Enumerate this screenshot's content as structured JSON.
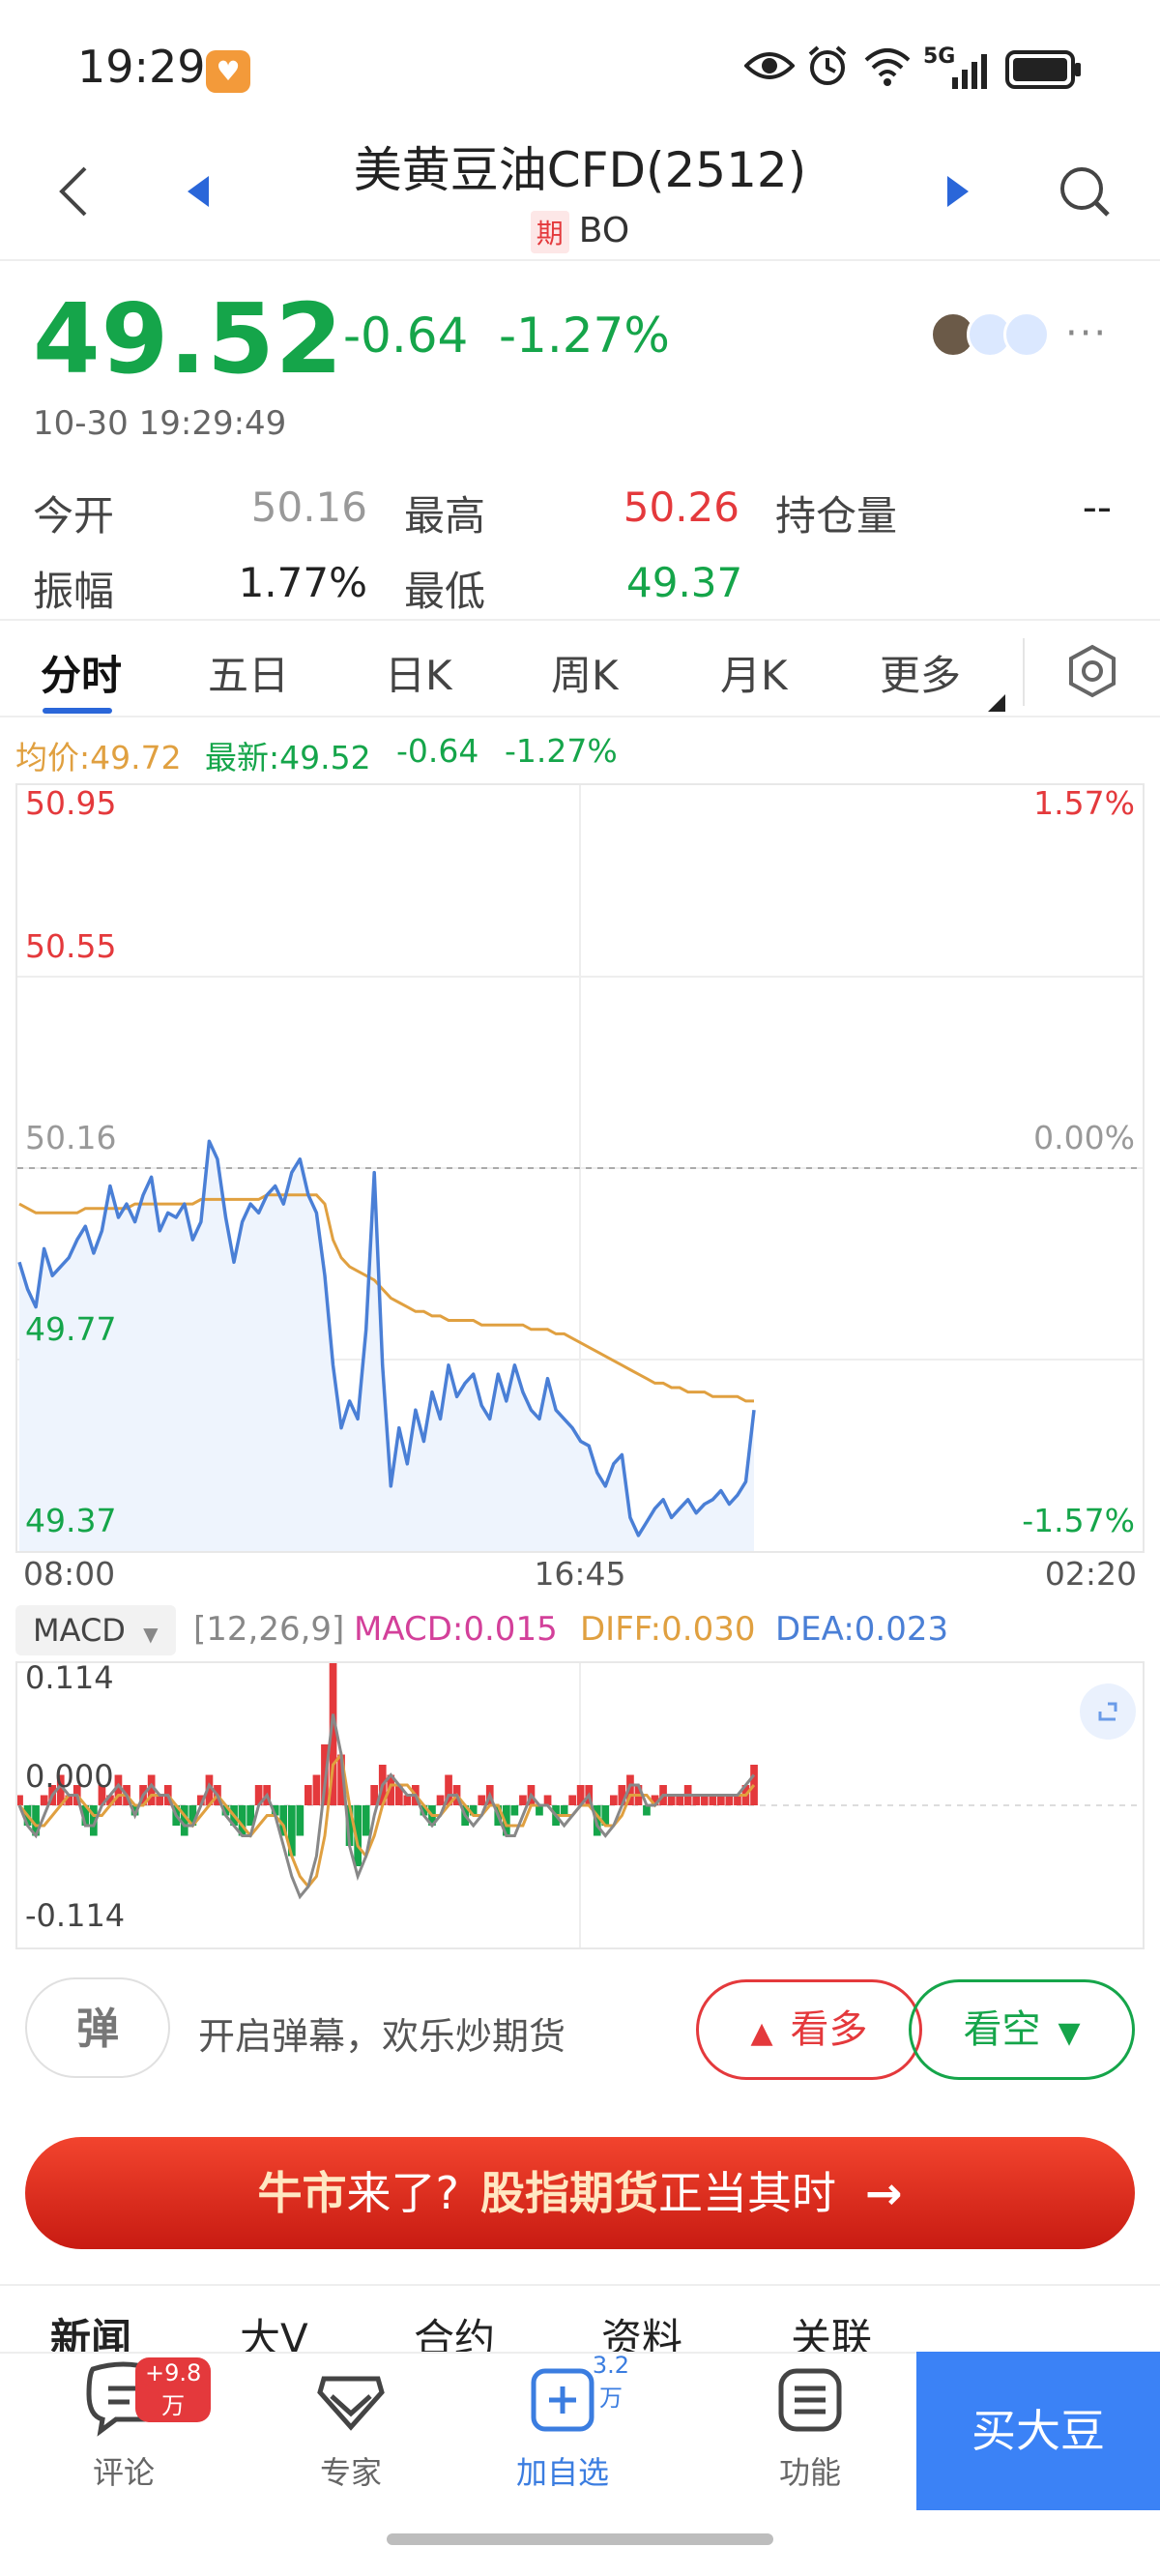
{
  "status_bar": {
    "time": "19:29",
    "network": "5G"
  },
  "header": {
    "title": "美黄豆油CFD(2512)",
    "tag": "期",
    "code": "BO"
  },
  "quote": {
    "price": "49.52",
    "change": "-0.64",
    "change_pct": "-1.27%",
    "time": "10-30 19:29:49",
    "more": "···"
  },
  "stats": [
    {
      "label": "今开",
      "value": "50.16",
      "color": "#999999"
    },
    {
      "label": "最高",
      "value": "50.26",
      "color": "#e4393c"
    },
    {
      "label": "持仓量",
      "value": "--",
      "color": "#222222"
    },
    {
      "label": "振幅",
      "value": "1.77%",
      "color": "#222222"
    },
    {
      "label": "最低",
      "value": "49.37",
      "color": "#15a54a"
    }
  ],
  "chart_tabs": [
    "分时",
    "五日",
    "日K",
    "周K",
    "月K",
    "更多"
  ],
  "legend": {
    "avg": "均价:49.72",
    "latest": "最新:49.52",
    "change": "-0.64",
    "change_pct": "-1.27%"
  },
  "macd_header": {
    "selector": "MACD",
    "params": "[12,26,9]",
    "macd": "MACD:0.015",
    "diff": "DIFF:0.030",
    "dea": "DEA:0.023"
  },
  "controls": {
    "danmu_icon": "弹",
    "danmu_text": "开启弹幕，欢乐炒期货",
    "long_label": "看多",
    "short_label": "看空"
  },
  "banner": {
    "part1": "牛市",
    "part2": "来了?",
    "part3": "股指期货",
    "part4": "正当其时",
    "arrow": "→"
  },
  "news_tabs": [
    "新闻",
    "大V",
    "合约",
    "资料",
    "关联"
  ],
  "bottom_nav": [
    {
      "label": "评论",
      "badge": "+9.8万",
      "icon": "comment-icon"
    },
    {
      "label": "专家",
      "badge": "",
      "icon": "diamond-icon"
    },
    {
      "label": "加自选",
      "badge": "3.2万",
      "icon": "add-watchlist-icon"
    },
    {
      "label": "功能",
      "badge": "",
      "icon": "menu-icon"
    }
  ],
  "buy_button": "买大豆",
  "chart_data": [
    {
      "type": "line",
      "x_ticks": [
        "08:00",
        "16:45",
        "02:20"
      ],
      "y_ticks_left": [
        "50.95",
        "50.55",
        "50.16",
        "49.77",
        "49.37"
      ],
      "y_ticks_right": [
        "1.57%",
        "0.00%",
        "-1.57%"
      ],
      "ylim": [
        49.37,
        50.95
      ],
      "reference": 50.16,
      "colors": {
        "price": "#4a7fd6",
        "avg": "#e0a040"
      },
      "series": [
        {
          "values": [
            49.95,
            49.89,
            49.85,
            49.98,
            49.92,
            49.94,
            49.96,
            50.0,
            50.03,
            49.97,
            50.02,
            50.12,
            50.05,
            50.08,
            50.04,
            50.1,
            50.14,
            50.02,
            50.06,
            50.05,
            50.08,
            50.0,
            50.04,
            50.22,
            50.18,
            50.05,
            49.95,
            50.04,
            50.08,
            50.06,
            50.1,
            50.12,
            50.08,
            50.15,
            50.18,
            50.1,
            50.06,
            49.92,
            49.72,
            49.58,
            49.64,
            49.6,
            49.8,
            50.15,
            49.72,
            49.45,
            49.58,
            49.5,
            49.62,
            49.55,
            49.66,
            49.6,
            49.72,
            49.65,
            49.68,
            49.7,
            49.63,
            49.6,
            49.7,
            49.64,
            49.72,
            49.66,
            49.62,
            49.6,
            49.69,
            49.62,
            49.6,
            49.58,
            49.55,
            49.54,
            49.48,
            49.45,
            49.5,
            49.52,
            49.38,
            49.34,
            49.37,
            49.4,
            49.42,
            49.38,
            49.4,
            49.42,
            49.39,
            49.41,
            49.42,
            49.44,
            49.41,
            49.43,
            49.46,
            49.62
          ]
        },
        {
          "values": [
            50.08,
            50.07,
            50.06,
            50.06,
            50.06,
            50.06,
            50.06,
            50.06,
            50.07,
            50.07,
            50.07,
            50.07,
            50.07,
            50.07,
            50.08,
            50.08,
            50.08,
            50.08,
            50.08,
            50.08,
            50.08,
            50.08,
            50.09,
            50.09,
            50.09,
            50.09,
            50.09,
            50.09,
            50.09,
            50.09,
            50.1,
            50.1,
            50.1,
            50.1,
            50.1,
            50.1,
            50.1,
            50.08,
            50.0,
            49.96,
            49.94,
            49.93,
            49.92,
            49.91,
            49.89,
            49.87,
            49.86,
            49.85,
            49.84,
            49.84,
            49.83,
            49.83,
            49.82,
            49.82,
            49.82,
            49.82,
            49.81,
            49.81,
            49.81,
            49.81,
            49.81,
            49.81,
            49.8,
            49.8,
            49.8,
            49.79,
            49.79,
            49.78,
            49.77,
            49.76,
            49.75,
            49.74,
            49.73,
            49.72,
            49.71,
            49.7,
            49.69,
            49.68,
            49.68,
            49.67,
            49.67,
            49.66,
            49.66,
            49.66,
            49.65,
            49.65,
            49.65,
            49.65,
            49.64,
            49.64
          ]
        }
      ]
    },
    {
      "type": "bar",
      "y_ticks": [
        "0.114",
        "0.000",
        "-0.114"
      ],
      "ylim": [
        -0.14,
        0.14
      ],
      "colors": {
        "up": "#e4393c",
        "down": "#15a54a",
        "diff": "#888888",
        "dea": "#e0a040"
      },
      "series": [
        {
          "values": [
            0.01,
            -0.02,
            -0.03,
            0.01,
            0.02,
            0.03,
            0.01,
            0.02,
            -0.02,
            -0.03,
            0.02,
            0.01,
            0.03,
            0.02,
            -0.01,
            0.02,
            0.03,
            0.01,
            0.02,
            -0.02,
            -0.03,
            -0.02,
            0.01,
            0.03,
            0.02,
            -0.01,
            -0.02,
            -0.03,
            -0.02,
            0.02,
            0.02,
            -0.01,
            -0.03,
            -0.05,
            -0.03,
            0.02,
            0.03,
            0.06,
            0.14,
            0.05,
            -0.04,
            -0.06,
            -0.03,
            0.02,
            0.04,
            0.03,
            0.02,
            0.01,
            0.02,
            -0.01,
            -0.02,
            0.01,
            0.03,
            0.02,
            -0.02,
            -0.01,
            0.01,
            0.02,
            -0.02,
            -0.03,
            -0.01,
            0.01,
            0.02,
            -0.01,
            0.01,
            -0.02,
            -0.01,
            0.01,
            0.02,
            0.02,
            -0.03,
            -0.02,
            0.01,
            0.02,
            0.03,
            0.02,
            -0.01,
            0.01,
            0.02,
            0.01,
            0.01,
            0.02,
            0.01,
            0.01,
            0.01,
            0.01,
            0.01,
            0.01,
            0.02,
            0.04
          ]
        },
        {
          "values": [
            0.0,
            -0.02,
            -0.03,
            -0.01,
            0.01,
            0.02,
            0.01,
            0.01,
            -0.02,
            -0.02,
            0.0,
            0.01,
            0.02,
            0.01,
            -0.01,
            0.01,
            0.02,
            0.01,
            0.01,
            -0.01,
            -0.02,
            -0.02,
            0.0,
            0.02,
            0.01,
            -0.01,
            -0.02,
            -0.03,
            -0.03,
            0.0,
            0.01,
            -0.01,
            -0.04,
            -0.07,
            -0.09,
            -0.08,
            -0.05,
            0.02,
            0.09,
            0.05,
            -0.04,
            -0.07,
            -0.05,
            -0.01,
            0.02,
            0.03,
            0.02,
            0.01,
            0.01,
            -0.01,
            -0.02,
            -0.01,
            0.01,
            0.01,
            -0.01,
            -0.02,
            -0.01,
            0.01,
            -0.01,
            -0.03,
            -0.03,
            -0.01,
            0.01,
            0.0,
            0.0,
            -0.01,
            -0.02,
            -0.01,
            0.0,
            0.01,
            -0.02,
            -0.03,
            -0.02,
            0.0,
            0.02,
            0.02,
            0.0,
            0.0,
            0.01,
            0.01,
            0.01,
            0.01,
            0.01,
            0.01,
            0.01,
            0.01,
            0.01,
            0.01,
            0.02,
            0.03
          ]
        },
        {
          "values": [
            0.0,
            -0.01,
            -0.02,
            -0.02,
            -0.01,
            0.0,
            0.01,
            0.01,
            0.0,
            -0.01,
            -0.01,
            0.0,
            0.01,
            0.01,
            0.0,
            0.0,
            0.01,
            0.01,
            0.01,
            0.0,
            -0.01,
            -0.02,
            -0.01,
            0.0,
            0.01,
            0.0,
            -0.01,
            -0.02,
            -0.03,
            -0.02,
            -0.01,
            -0.01,
            -0.02,
            -0.05,
            -0.07,
            -0.08,
            -0.07,
            -0.03,
            0.04,
            0.05,
            0.0,
            -0.04,
            -0.05,
            -0.03,
            0.0,
            0.02,
            0.02,
            0.02,
            0.01,
            0.0,
            -0.01,
            -0.01,
            0.0,
            0.01,
            0.0,
            -0.01,
            -0.01,
            0.0,
            0.0,
            -0.02,
            -0.02,
            -0.02,
            0.0,
            0.0,
            0.0,
            -0.01,
            -0.01,
            -0.01,
            0.0,
            0.0,
            -0.01,
            -0.02,
            -0.02,
            -0.01,
            0.01,
            0.01,
            0.01,
            0.0,
            0.01,
            0.01,
            0.01,
            0.01,
            0.01,
            0.01,
            0.01,
            0.01,
            0.01,
            0.01,
            0.01,
            0.02
          ]
        }
      ]
    }
  ]
}
